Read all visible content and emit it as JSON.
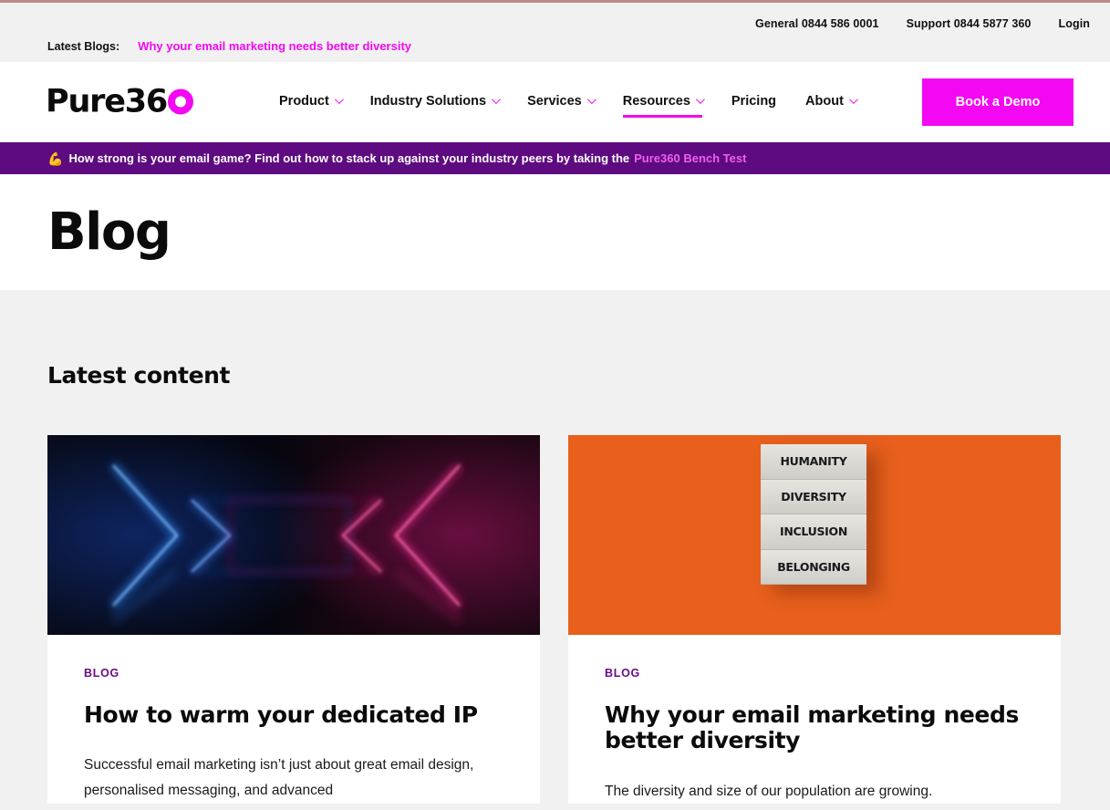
{
  "theme": {
    "magenta": "#f408f4",
    "purple": "#5e0a80",
    "kicker_purple": "#6b0b85",
    "grey_bg": "#f1f1f1",
    "hairline": "#c08b8b",
    "orange": "#e8601c"
  },
  "utility_bar": {
    "links": [
      {
        "label": "General 0844 586 0001",
        "name": "general-phone-link"
      },
      {
        "label": "Support 0844 5877 360",
        "name": "support-phone-link"
      },
      {
        "label": "Login",
        "name": "login-link"
      }
    ],
    "latest_blogs_label": "Latest Blogs:",
    "latest_blogs_link": "Why your email marketing needs better diversity"
  },
  "header": {
    "logo_text": "Pure36",
    "logo_icon": "magenta-ring-o",
    "nav": [
      {
        "label": "Product",
        "has_caret": true,
        "active": false
      },
      {
        "label": "Industry Solutions",
        "has_caret": true,
        "active": false
      },
      {
        "label": "Services",
        "has_caret": true,
        "active": false
      },
      {
        "label": "Resources",
        "has_caret": true,
        "active": true
      },
      {
        "label": "Pricing",
        "has_caret": false,
        "active": false
      },
      {
        "label": "About",
        "has_caret": true,
        "active": false
      }
    ],
    "cta_label": "Book a Demo"
  },
  "promo_banner": {
    "emoji": "💪",
    "emoji_name": "flexed-biceps-emoji",
    "text": "How strong is your email game? Find out how to stack up against your industry peers by taking the",
    "link_label": "Pure360 Bench Test"
  },
  "page": {
    "title": "Blog",
    "section_heading": "Latest content"
  },
  "cards": [
    {
      "kicker": "BLOG",
      "title": "How to warm your dedicated IP",
      "excerpt": "Successful email marketing isn’t just about great email design, personalised messaging, and advanced",
      "media": "neon-chevrons-dark-room",
      "media_alt": "Neon blue and pink chevron arrows glowing in a dark room"
    },
    {
      "kicker": "BLOG",
      "title": "Why your email marketing needs better diversity",
      "excerpt": "The diversity and size of our population are growing.",
      "media": "diversity-word-blocks-orange",
      "media_alt": "Stacked blocks on an orange background reading HUMANITY, DIVERSITY, INCLUSION, BELONGING",
      "media_words": [
        "HUMANITY",
        "DIVERSITY",
        "INCLUSION",
        "BELONGING"
      ]
    }
  ]
}
